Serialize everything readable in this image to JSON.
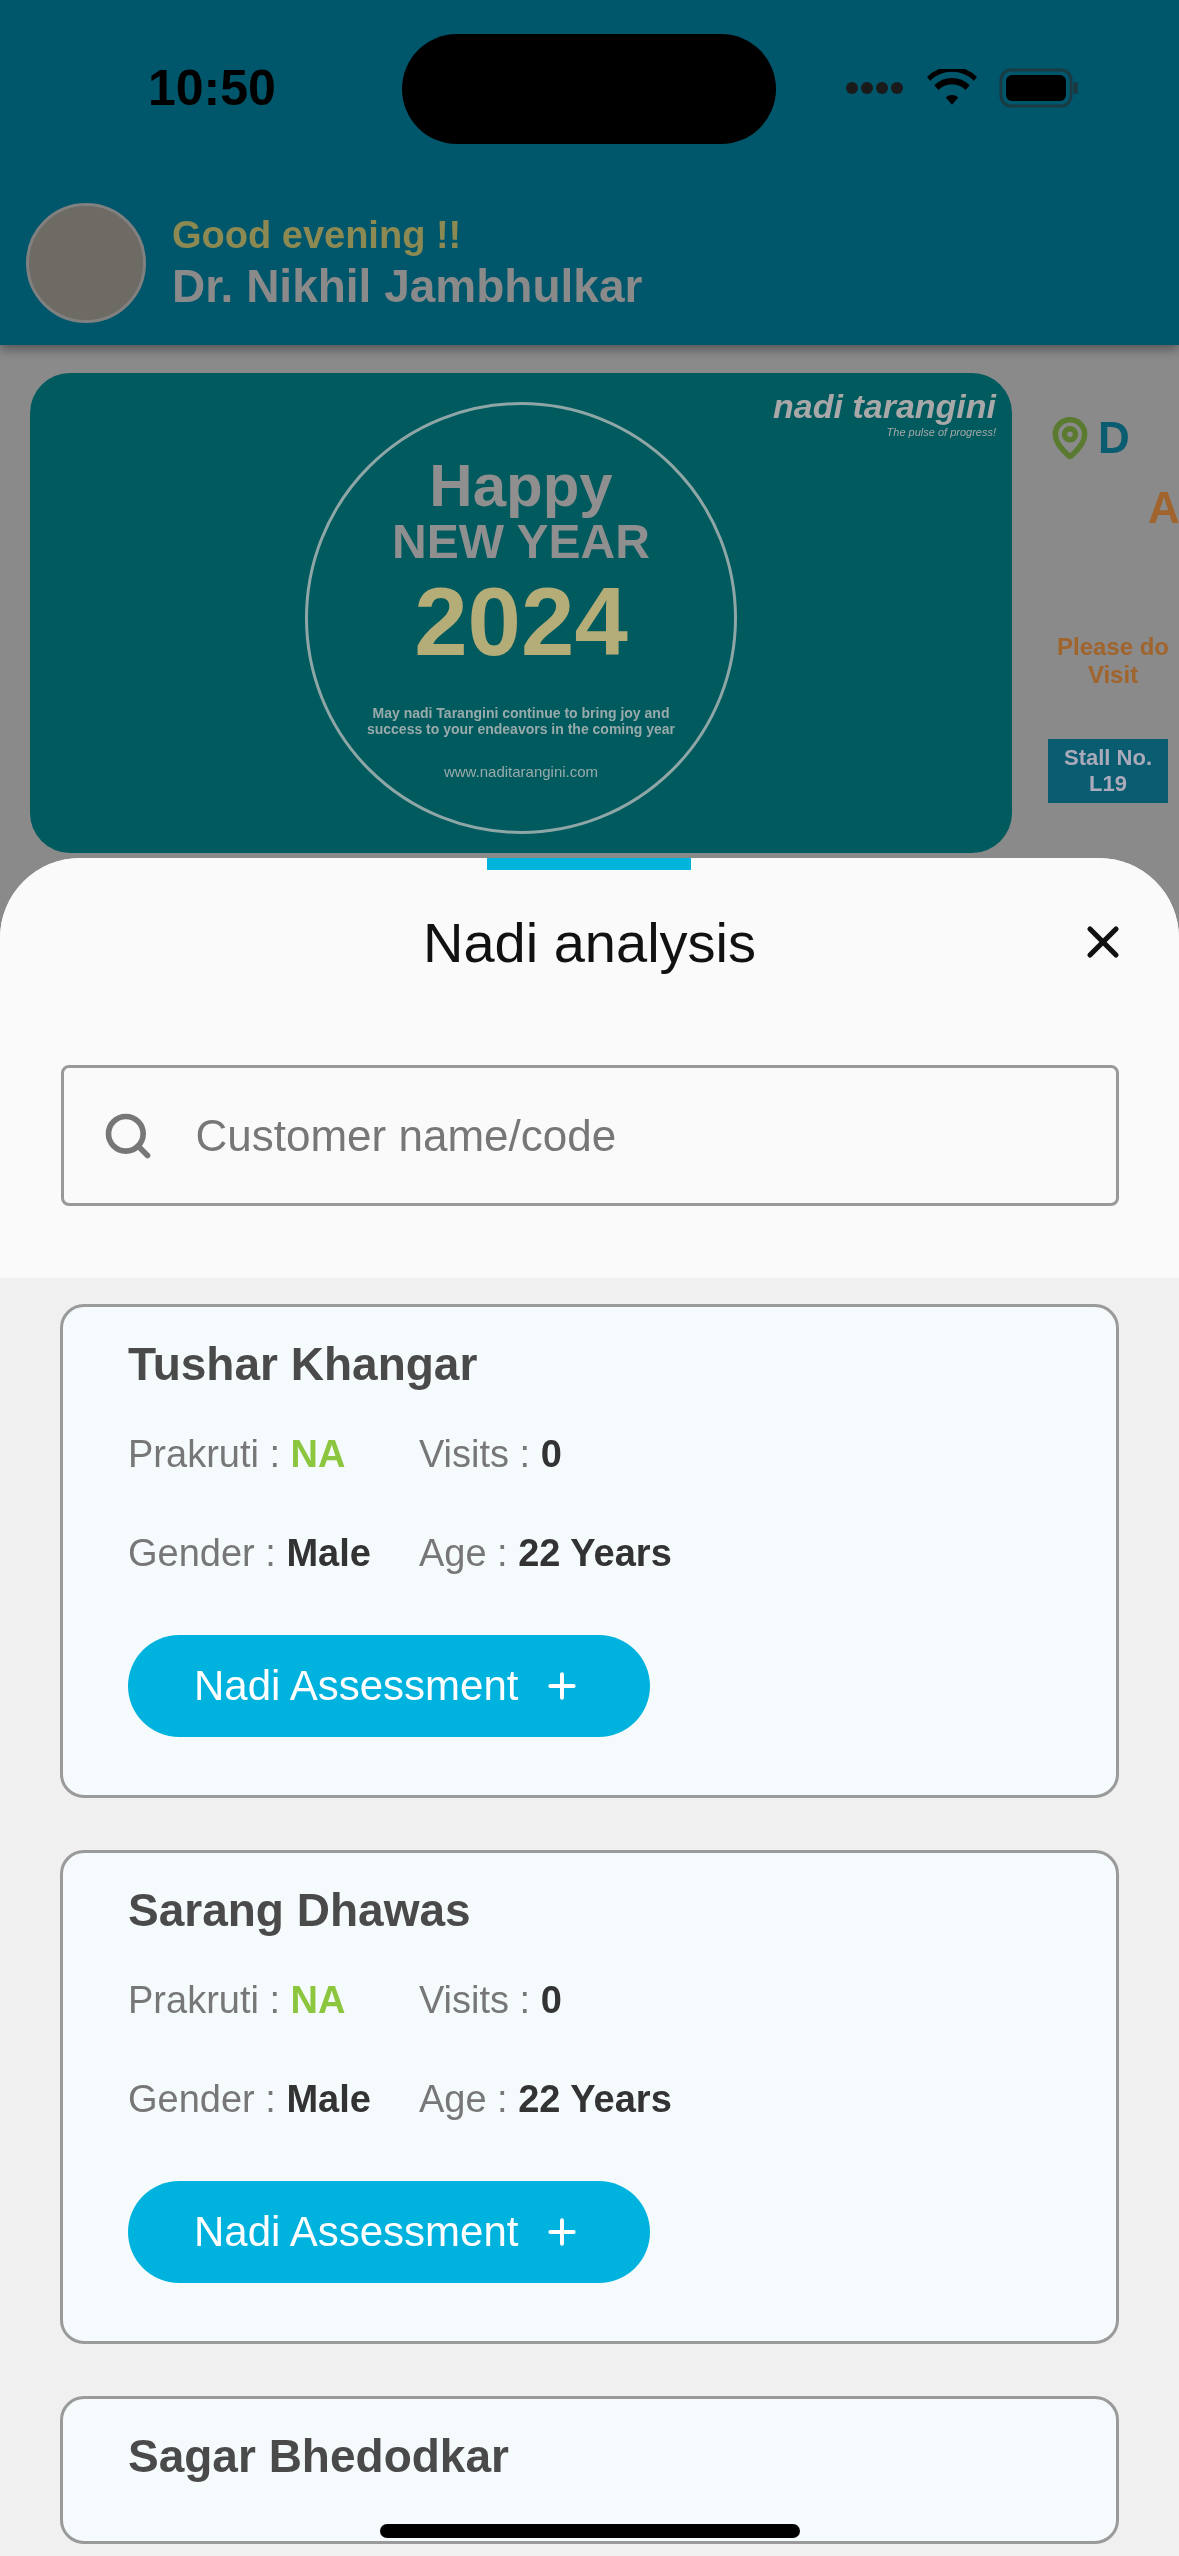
{
  "status_bar": {
    "time": "10:50"
  },
  "header": {
    "greeting": "Good evening !!",
    "user_name": "Dr. Nikhil Jambhulkar"
  },
  "banner": {
    "logo": "nadi tarangini",
    "tagline": "The pulse of progress!",
    "line_1": "Happy",
    "line_2": "NEW YEAR",
    "line_3": "2024",
    "message": "May nadi Tarangini continue to bring joy and success to your endeavors in the coming year",
    "url": "www.naditarangini.com"
  },
  "promo_card": {
    "heading": "D",
    "subheading": "A",
    "invite": "Please do Visit",
    "stall": "Stall No. L19"
  },
  "sheet": {
    "title": "Nadi analysis",
    "search": {
      "placeholder": "Customer name/code"
    },
    "customers": [
      {
        "name": "Tushar Khangar",
        "details": [
          {
            "label": "Prakruti :",
            "value": "NA",
            "kind": "highlight"
          },
          {
            "label": "Visits :",
            "value": "0",
            "kind": "plain"
          },
          {
            "label": "Gender :",
            "value": "Male",
            "kind": "plain"
          },
          {
            "label": "Age :",
            "value": "22 Years",
            "kind": "plain"
          }
        ],
        "button": "Nadi Assessment"
      },
      {
        "name": "Sarang Dhawas",
        "details": [
          {
            "label": "Prakruti :",
            "value": "NA",
            "kind": "highlight"
          },
          {
            "label": "Visits :",
            "value": "0",
            "kind": "plain"
          },
          {
            "label": "Gender :",
            "value": "Male",
            "kind": "plain"
          },
          {
            "label": "Age :",
            "value": "22 Years",
            "kind": "plain"
          }
        ],
        "button": "Nadi Assessment"
      },
      {
        "name": "Sagar Bhedodkar"
      }
    ]
  }
}
